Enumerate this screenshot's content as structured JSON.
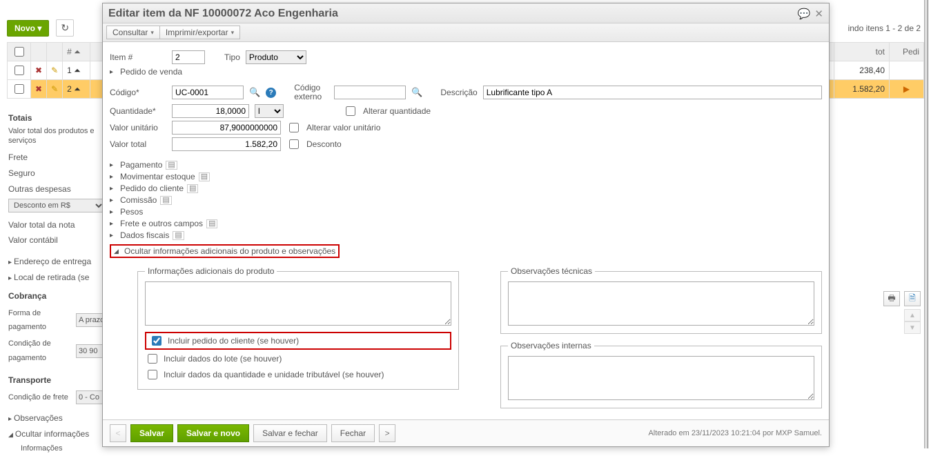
{
  "bg": {
    "novo": "Novo",
    "status": "indo itens 1 - 2 de 2",
    "cols": {
      "tot": "tot",
      "pedi": "Pedi"
    },
    "rows": [
      {
        "seq": "1",
        "tot": "238,40",
        "pedi": ""
      },
      {
        "seq": "2",
        "tot": "1.582,20",
        "pedi": ""
      }
    ]
  },
  "sidebar": {
    "totais": "Totais",
    "valor_total_prod": "Valor total dos produtos e serviços",
    "frete": "Frete",
    "seguro": "Seguro",
    "outras": "Outras despesas",
    "desconto_sel": "Desconto em R$",
    "vt_nota": "Valor total da nota",
    "v_contabil": "Valor contábil",
    "end_entrega": "Endereço de entrega",
    "local_retirada": "Local de retirada (se",
    "cobranca": "Cobrança",
    "forma_pag": "Forma de pagamento",
    "forma_val": "A prazo",
    "cond_pag": "Condição de pagamento",
    "cond_val": "30 90",
    "transporte": "Transporte",
    "cond_frete": "Condição de frete",
    "cond_frete_val": "0 - Co",
    "observ": "Observações",
    "ocultar_info": "Ocultar informações",
    "info": "Informações"
  },
  "modal": {
    "title": "Editar item da NF 10000072 Aco Engenharia",
    "toolbar": {
      "consultar": "Consultar",
      "imprimir": "Imprimir/exportar"
    },
    "fields": {
      "item_label": "Item #",
      "item_val": "2",
      "tipo_label": "Tipo",
      "tipo_val": "Produto",
      "pedido_venda": "Pedido de venda",
      "codigo_label": "Código*",
      "codigo_val": "UC-0001",
      "codigo_ext_label": "Código externo",
      "codigo_ext_val": "",
      "desc_label": "Descrição",
      "desc_val": "Lubrificante tipo A",
      "qtd_label": "Quantidade*",
      "qtd_val": "18,0000",
      "unid_val": "l",
      "alt_qtd": "Alterar quantidade",
      "vu_label": "Valor unitário",
      "vu_val": "87,9000000000",
      "alt_vu": "Alterar valor unitário",
      "vt_label": "Valor total",
      "vt_val": "1.582,20",
      "desconto": "Desconto"
    },
    "sections": {
      "pag": "Pagamento",
      "estoque": "Movimentar estoque",
      "pedcli": "Pedido do cliente",
      "comissao": "Comissão",
      "pesos": "Pesos",
      "frete": "Frete e outros campos",
      "fiscais": "Dados fiscais",
      "ocultar": "Ocultar informações adicionais do produto e observações"
    },
    "fieldsets": {
      "info_adic": "Informações adicionais do produto",
      "obs_tec": "Observações técnicas",
      "obs_int": "Observações internas"
    },
    "checks": {
      "inc_pedido": "Incluir pedido do cliente (se houver)",
      "inc_lote": "Incluir dados do lote (se houver)",
      "inc_qtd": "Incluir dados da quantidade e unidade tributável (se houver)"
    },
    "footer": {
      "salvar": "Salvar",
      "salvar_novo": "Salvar e novo",
      "salvar_fechar": "Salvar e fechar",
      "fechar": "Fechar",
      "audit": "Alterado em 23/11/2023 10:21:04 por MXP Samuel."
    }
  }
}
